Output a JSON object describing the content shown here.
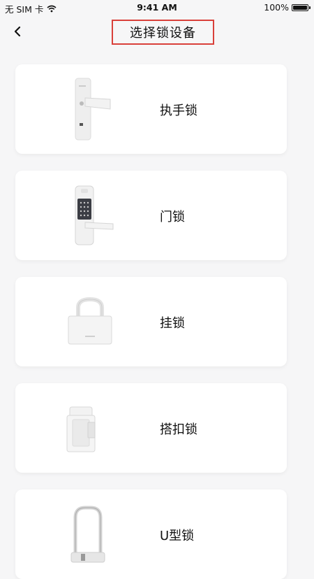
{
  "status_bar": {
    "carrier": "无 SIM 卡",
    "time": "9:41 AM",
    "battery": "100%"
  },
  "nav": {
    "title": "选择锁设备",
    "back_icon": "chevron-left-icon"
  },
  "devices": [
    {
      "label": "执手锁",
      "icon": "lever-handle-lock-image"
    },
    {
      "label": "门锁",
      "icon": "keypad-door-lock-image"
    },
    {
      "label": "挂锁",
      "icon": "padlock-image"
    },
    {
      "label": "搭扣锁",
      "icon": "hasp-lock-image"
    },
    {
      "label": "U型锁",
      "icon": "u-lock-image"
    }
  ],
  "colors": {
    "background": "#f6f6f7",
    "card": "#ffffff",
    "highlight_border": "#d9403a"
  }
}
